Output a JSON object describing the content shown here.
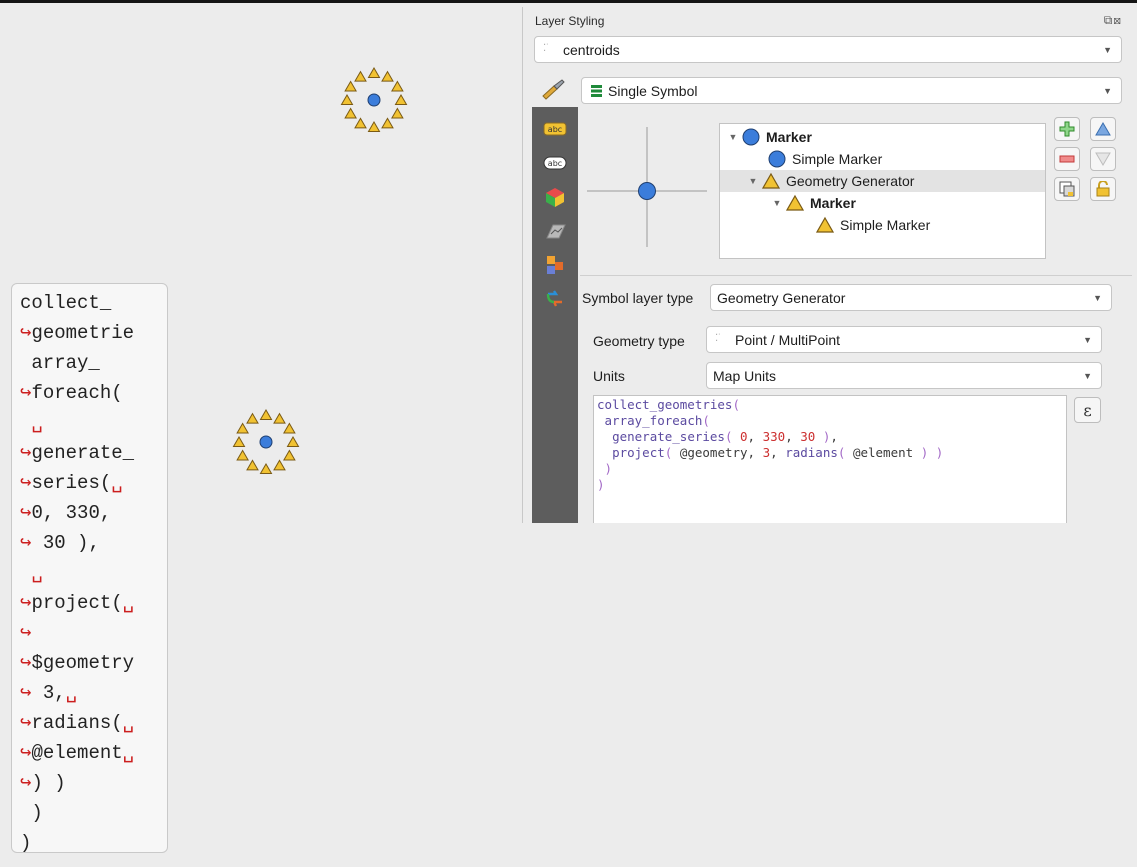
{
  "map": {
    "symbols": [
      {
        "name": "upper"
      },
      {
        "name": "lower"
      }
    ]
  },
  "code_block": {
    "lines": [
      {
        "arrow_start": "",
        "text": "collect_",
        "arrow_end": ""
      },
      {
        "arrow_start": "↪",
        "text": "geometrie",
        "arrow_end": ""
      },
      {
        "arrow_start": "",
        "text": " array_",
        "arrow_end": ""
      },
      {
        "arrow_start": "↪",
        "text": "foreach(",
        "arrow_end": ""
      },
      {
        "arrow_start": "",
        "text": " ",
        "arrow_end": "␣"
      },
      {
        "arrow_start": "↪",
        "text": "generate_",
        "arrow_end": ""
      },
      {
        "arrow_start": "↪",
        "text": "series(",
        "arrow_end": "␣"
      },
      {
        "arrow_start": "↪",
        "text": "0, 330,",
        "arrow_end": ""
      },
      {
        "arrow_start": "↪",
        "text": " 30 ),",
        "arrow_end": ""
      },
      {
        "arrow_start": "",
        "text": " ",
        "arrow_end": "␣"
      },
      {
        "arrow_start": "↪",
        "text": "project(",
        "arrow_end": "␣"
      },
      {
        "arrow_start": "↪",
        "text": "",
        "arrow_end": ""
      },
      {
        "arrow_start": "↪",
        "text": "$geometry",
        "arrow_end": ""
      },
      {
        "arrow_start": "↪",
        "text": " 3,",
        "arrow_end": "␣"
      },
      {
        "arrow_start": "↪",
        "text": "radians(",
        "arrow_end": "␣"
      },
      {
        "arrow_start": "↪",
        "text": "@element",
        "arrow_end": "␣"
      },
      {
        "arrow_start": "↪",
        "text": ") )",
        "arrow_end": ""
      },
      {
        "arrow_start": "",
        "text": " )",
        "arrow_end": ""
      },
      {
        "arrow_start": "",
        "text": ")",
        "arrow_end": ""
      }
    ]
  },
  "panel": {
    "title": "Layer Styling",
    "layer_combo": "centroids",
    "renderer_combo": "Single Symbol",
    "tree": [
      {
        "label": "Marker",
        "bold": true,
        "icon": "circle-icon"
      },
      {
        "label": "Simple Marker",
        "bold": false,
        "icon": "circle-icon"
      },
      {
        "label": "Geometry Generator",
        "bold": false,
        "icon": "triangle-icon"
      },
      {
        "label": "Marker",
        "bold": true,
        "icon": "triangle-icon"
      },
      {
        "label": "Simple Marker",
        "bold": false,
        "icon": "triangle-icon"
      }
    ],
    "symbol_layer_type_label": "Symbol layer type",
    "symbol_layer_type_value": "Geometry Generator",
    "geometry_type_label": "Geometry type",
    "geometry_type_value": "Point / MultiPoint",
    "units_label": "Units",
    "units_value": "Map Units",
    "epsilon": "ε",
    "expression": [
      [
        {
          "c": "fn",
          "t": "collect_geometries"
        },
        {
          "c": "paren",
          "t": "("
        }
      ],
      [
        {
          "c": "var",
          "t": " "
        },
        {
          "c": "fn",
          "t": "array_foreach"
        },
        {
          "c": "paren",
          "t": "("
        }
      ],
      [
        {
          "c": "var",
          "t": "  "
        },
        {
          "c": "fn",
          "t": "generate_series"
        },
        {
          "c": "paren",
          "t": "( "
        },
        {
          "c": "num",
          "t": "0"
        },
        {
          "c": "var",
          "t": ", "
        },
        {
          "c": "num",
          "t": "330"
        },
        {
          "c": "var",
          "t": ", "
        },
        {
          "c": "num",
          "t": "30"
        },
        {
          "c": "paren",
          "t": " )"
        },
        {
          "c": "var",
          "t": ","
        }
      ],
      [
        {
          "c": "var",
          "t": "  "
        },
        {
          "c": "fn",
          "t": "project"
        },
        {
          "c": "paren",
          "t": "( "
        },
        {
          "c": "var",
          "t": "@geometry, "
        },
        {
          "c": "num",
          "t": "3"
        },
        {
          "c": "var",
          "t": ", "
        },
        {
          "c": "fn",
          "t": "radians"
        },
        {
          "c": "paren",
          "t": "( "
        },
        {
          "c": "var",
          "t": "@element"
        },
        {
          "c": "paren",
          "t": " ) )"
        }
      ],
      [
        {
          "c": "paren",
          "t": " )"
        }
      ],
      [
        {
          "c": "paren",
          "t": ")"
        }
      ]
    ]
  },
  "colors": {
    "marker_blue": "#3b7ddb",
    "triangle_yellow": "#f1c232",
    "triangle_stroke": "#7a5a14",
    "wrap_arrow_red": "#cc1e1e"
  }
}
